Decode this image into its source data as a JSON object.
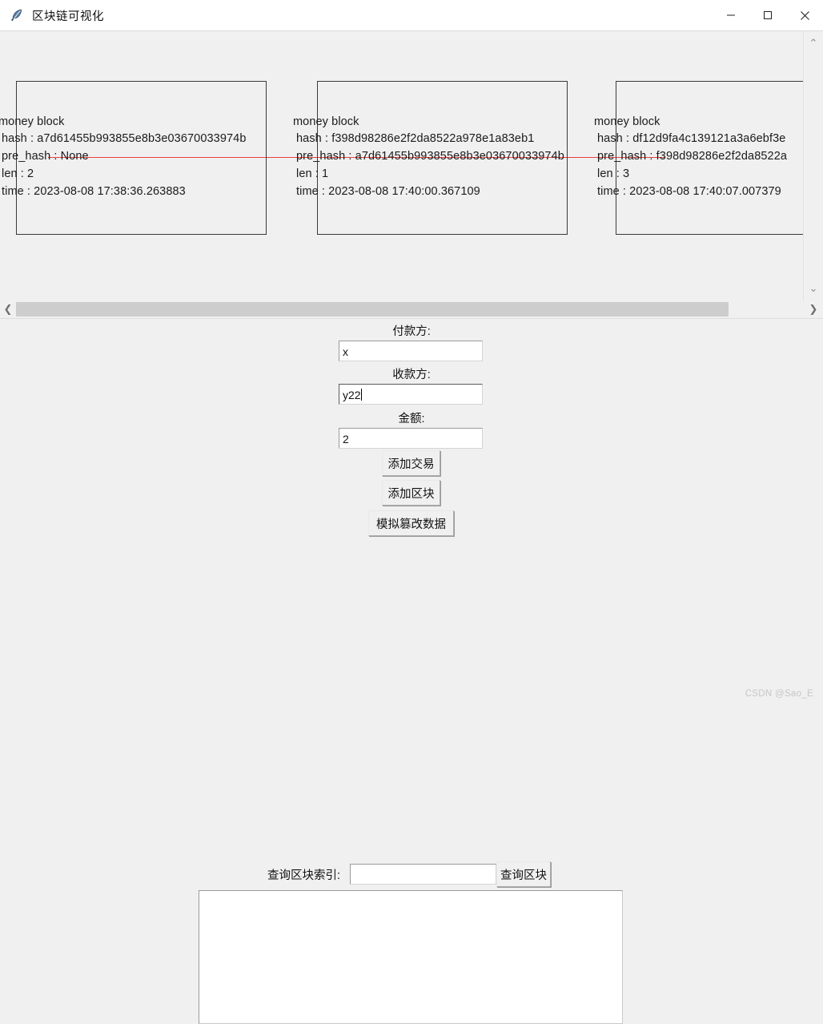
{
  "window": {
    "title": "区块链可视化",
    "icon": "feather-icon",
    "controls": {
      "minimize": "—",
      "maximize": "▢",
      "close": "✕"
    }
  },
  "canvas": {
    "link_color": "#e8433f",
    "blocks": [
      {
        "title": "money block",
        "hash_line": "hash : a7d61455b993855e8b3e03670033974b",
        "pre_hash_line": "pre_hash : None",
        "len_line": "len : 2",
        "time_line": "time : 2023-08-08 17:38:36.263883"
      },
      {
        "title": "money block",
        "hash_line": "hash : f398d98286e2f2da8522a978e1a83eb1",
        "pre_hash_line": "pre_hash : a7d61455b993855e8b3e03670033974b",
        "len_line": "len : 1",
        "time_line": "time : 2023-08-08 17:40:00.367109"
      },
      {
        "title": "money block",
        "hash_line": "hash : df12d9fa4c139121a3a6ebf3e",
        "pre_hash_line": "pre_hash : f398d98286e2f2da8522a",
        "len_line": "len : 3",
        "time_line": "time : 2023-08-08 17:40:07.007379"
      }
    ]
  },
  "scrollbars": {
    "vertical": {
      "up": "⌃",
      "down": "⌄"
    },
    "horizontal": {
      "left": "❮",
      "right": "❯"
    }
  },
  "form": {
    "payer_label": "付款方:",
    "payer_value": "x",
    "payee_label": "收款方:",
    "payee_value": "y22",
    "amount_label": "金额:",
    "amount_value": "2",
    "add_transaction_button": "添加交易",
    "add_block_button": "添加区块",
    "tamper_button": "模拟篡改数据",
    "query_label": "查询区块索引:",
    "query_value": "",
    "query_button": "查询区块",
    "output_value": ""
  },
  "watermark": "CSDN @Sao_E"
}
